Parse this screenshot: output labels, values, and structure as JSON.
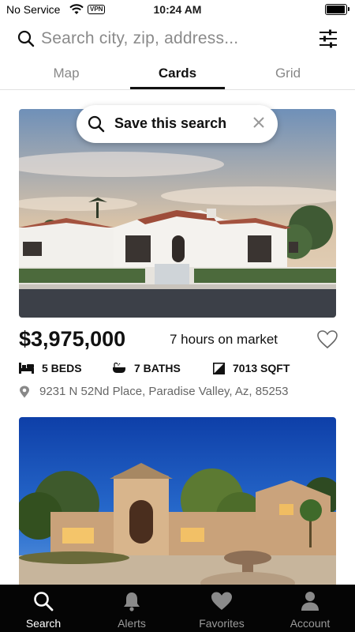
{
  "status_bar": {
    "carrier": "No Service",
    "vpn": "VPN",
    "time": "10:24 AM"
  },
  "search": {
    "placeholder": "Search city, zip, address..."
  },
  "tabs": [
    {
      "label": "Map",
      "active": false
    },
    {
      "label": "Cards",
      "active": true
    },
    {
      "label": "Grid",
      "active": false
    }
  ],
  "save_search": {
    "label": "Save this search"
  },
  "listings": [
    {
      "price": "$3,975,000",
      "time_on_market": "7 hours on market",
      "beds": "5 BEDS",
      "baths": "7 BATHS",
      "sqft": "7013 SQFT",
      "address": "9231 N 52Nd Place, Paradise Valley, Az, 85253"
    }
  ],
  "bottom_nav": [
    {
      "label": "Search",
      "icon": "search-icon",
      "active": true
    },
    {
      "label": "Alerts",
      "icon": "bell-icon",
      "active": false
    },
    {
      "label": "Favorites",
      "icon": "heart-icon",
      "active": false
    },
    {
      "label": "Account",
      "icon": "person-icon",
      "active": false
    }
  ],
  "colors": {
    "accent": "#111111",
    "nav_background": "#050505",
    "nav_active": "#ffffff",
    "nav_inactive": "#9b9b9b"
  }
}
